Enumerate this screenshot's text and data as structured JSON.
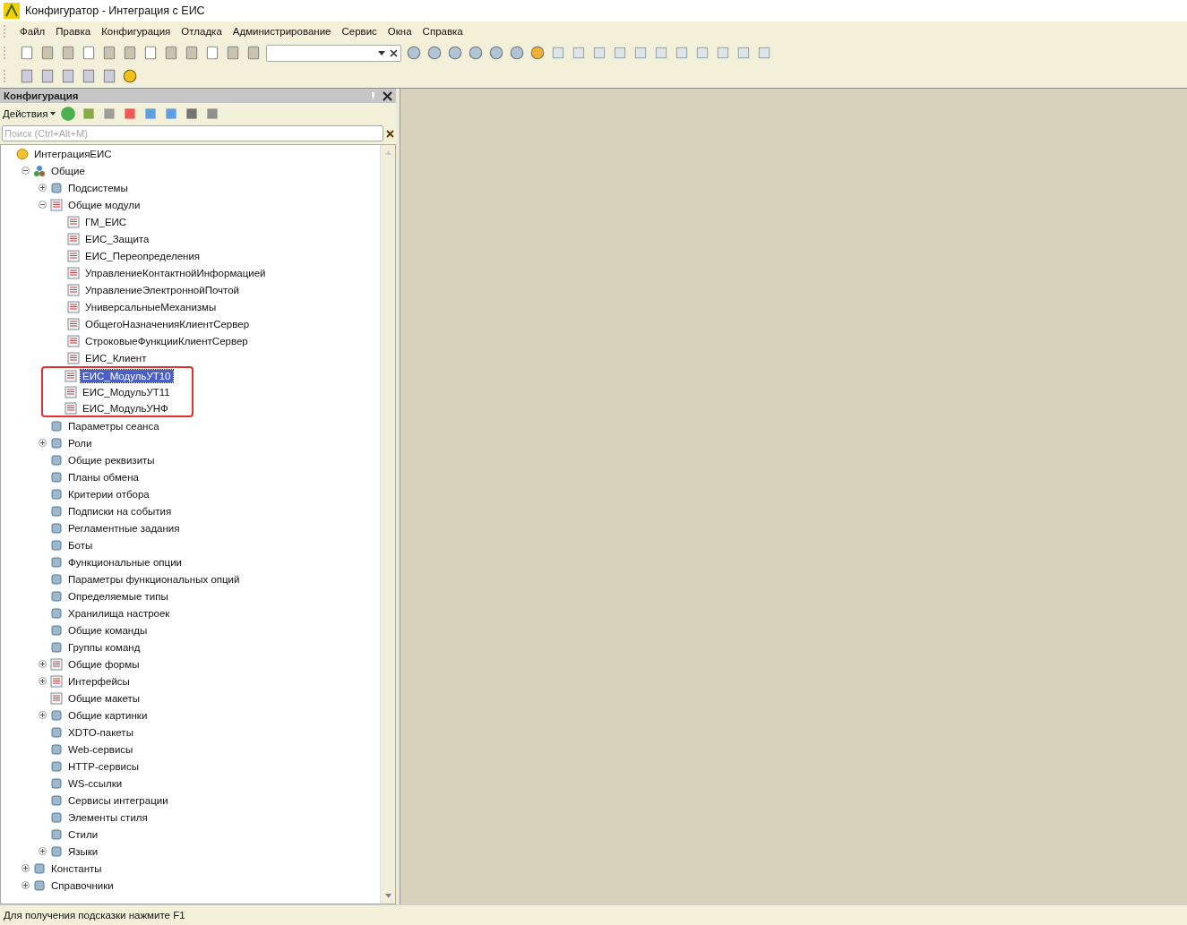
{
  "window": {
    "title": "Конфигуратор - Интеграция с ЕИС"
  },
  "menu": [
    "Файл",
    "Правка",
    "Конфигурация",
    "Отладка",
    "Администрирование",
    "Сервис",
    "Окна",
    "Справка"
  ],
  "panel": {
    "title": "Конфигурация",
    "actions_label": "Действия",
    "search": {
      "placeholder": "Поиск (Ctrl+Alt+M)"
    }
  },
  "tree": [
    {
      "label": "ИнтеграцияЕИС",
      "kind": "root",
      "selected": false,
      "annotated": false,
      "children": [
        {
          "label": "Общие",
          "kind": "group",
          "expanded": true,
          "selected": false,
          "annotated": false,
          "children": [
            {
              "label": "Подсистемы",
              "kind": "object",
              "expanded": false,
              "selected": false,
              "annotated": false
            },
            {
              "label": "Общие модули",
              "kind": "module",
              "expanded": true,
              "selected": false,
              "annotated": false,
              "children": [
                {
                  "label": "ГМ_ЕИС",
                  "kind": "module",
                  "selected": false,
                  "annotated": false
                },
                {
                  "label": "ЕИС_Защита",
                  "kind": "module",
                  "selected": false,
                  "annotated": false
                },
                {
                  "label": "ЕИС_Переопределения",
                  "kind": "module",
                  "selected": false,
                  "annotated": false
                },
                {
                  "label": "УправлениеКонтактнойИнформацией",
                  "kind": "module",
                  "selected": false,
                  "annotated": false
                },
                {
                  "label": "УправлениеЭлектроннойПочтой",
                  "kind": "module",
                  "selected": false,
                  "annotated": false
                },
                {
                  "label": "УниверсальныеМеханизмы",
                  "kind": "module",
                  "selected": false,
                  "annotated": false
                },
                {
                  "label": "ОбщегоНазначенияКлиентСервер",
                  "kind": "module",
                  "selected": false,
                  "annotated": false
                },
                {
                  "label": "СтроковыеФункцииКлиентСервер",
                  "kind": "module",
                  "selected": false,
                  "annotated": false
                },
                {
                  "label": "ЕИС_Клиент",
                  "kind": "module",
                  "selected": false,
                  "annotated": false
                },
                {
                  "label": "ЕИС_МодульУТ10",
                  "kind": "module",
                  "selected": true,
                  "annotated": true
                },
                {
                  "label": "ЕИС_МодульУТ11",
                  "kind": "module",
                  "selected": false,
                  "annotated": true
                },
                {
                  "label": "ЕИС_МодульУНФ",
                  "kind": "module",
                  "selected": false,
                  "annotated": true
                }
              ]
            },
            {
              "label": "Параметры сеанса",
              "kind": "object",
              "selected": false,
              "annotated": false
            },
            {
              "label": "Роли",
              "kind": "object",
              "expanded": false,
              "selected": false,
              "annotated": false
            },
            {
              "label": "Общие реквизиты",
              "kind": "object",
              "selected": false,
              "annotated": false
            },
            {
              "label": "Планы обмена",
              "kind": "object",
              "selected": false,
              "annotated": false
            },
            {
              "label": "Критерии отбора",
              "kind": "object",
              "selected": false,
              "annotated": false
            },
            {
              "label": "Подписки на события",
              "kind": "object",
              "selected": false,
              "annotated": false
            },
            {
              "label": "Регламентные задания",
              "kind": "object",
              "selected": false,
              "annotated": false
            },
            {
              "label": "Боты",
              "kind": "object",
              "selected": false,
              "annotated": false
            },
            {
              "label": "Функциональные опции",
              "kind": "object",
              "selected": false,
              "annotated": false
            },
            {
              "label": "Параметры функциональных опций",
              "kind": "object",
              "selected": false,
              "annotated": false
            },
            {
              "label": "Определяемые типы",
              "kind": "object",
              "selected": false,
              "annotated": false
            },
            {
              "label": "Хранилища настроек",
              "kind": "object",
              "selected": false,
              "annotated": false
            },
            {
              "label": "Общие команды",
              "kind": "object",
              "selected": false,
              "annotated": false
            },
            {
              "label": "Группы команд",
              "kind": "object",
              "selected": false,
              "annotated": false
            },
            {
              "label": "Общие формы",
              "kind": "module",
              "expanded": false,
              "selected": false,
              "annotated": false
            },
            {
              "label": "Интерфейсы",
              "kind": "module",
              "expanded": false,
              "selected": false,
              "annotated": false
            },
            {
              "label": "Общие макеты",
              "kind": "module",
              "selected": false,
              "annotated": false
            },
            {
              "label": "Общие картинки",
              "kind": "object",
              "expanded": false,
              "selected": false,
              "annotated": false
            },
            {
              "label": "XDTO-пакеты",
              "kind": "object",
              "selected": false,
              "annotated": false
            },
            {
              "label": "Web-сервисы",
              "kind": "object",
              "selected": false,
              "annotated": false
            },
            {
              "label": "HTTP-сервисы",
              "kind": "object",
              "selected": false,
              "annotated": false
            },
            {
              "label": "WS-ссылки",
              "kind": "object",
              "selected": false,
              "annotated": false
            },
            {
              "label": "Сервисы интеграции",
              "kind": "object",
              "selected": false,
              "annotated": false
            },
            {
              "label": "Элементы стиля",
              "kind": "object",
              "selected": false,
              "annotated": false
            },
            {
              "label": "Стили",
              "kind": "object",
              "selected": false,
              "annotated": false
            },
            {
              "label": "Языки",
              "kind": "object",
              "expanded": false,
              "selected": false,
              "annotated": false
            }
          ]
        },
        {
          "label": "Константы",
          "kind": "object",
          "expanded": false,
          "selected": false,
          "annotated": false
        },
        {
          "label": "Справочники",
          "kind": "object",
          "expanded": false,
          "selected": false,
          "annotated": false
        }
      ]
    }
  ],
  "status_bar": "Для получения подсказки нажмите F1"
}
